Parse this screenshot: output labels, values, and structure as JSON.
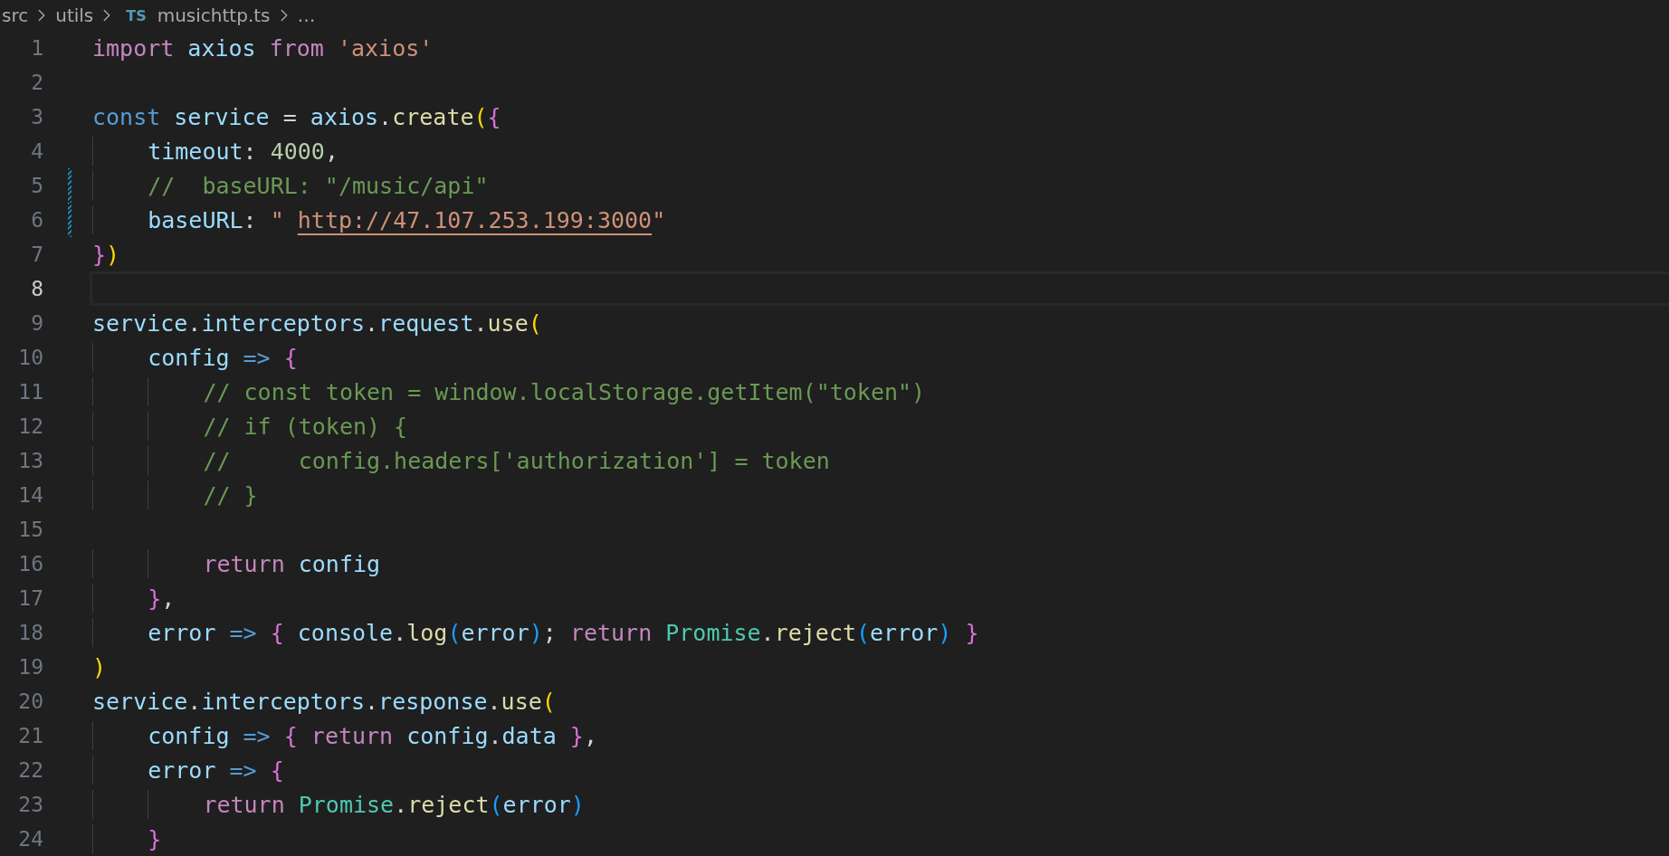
{
  "breadcrumb": [
    {
      "label": "src"
    },
    {
      "label": "utils"
    },
    {
      "label": "musichttp.ts",
      "badge": "TS"
    },
    {
      "label": "…"
    }
  ],
  "lines": [
    {
      "number": "1",
      "current": false,
      "modified": false,
      "tokens": [
        {
          "t": "import",
          "kind": "keyword"
        },
        {
          "t": " axios",
          "kind": "var"
        },
        {
          "t": " from",
          "kind": "keyword"
        },
        {
          "t": " 'axios'",
          "kind": "string"
        }
      ]
    },
    {
      "number": "2",
      "current": false,
      "modified": false
    },
    {
      "number": "3",
      "current": false,
      "modified": false,
      "tokens": [
        {
          "t": "const",
          "kind": "storage"
        },
        {
          "t": " service",
          "kind": "var"
        },
        {
          "t": " = ",
          "kind": "plain"
        },
        {
          "t": "axios",
          "kind": "var"
        },
        {
          "t": ".",
          "kind": "plain"
        },
        {
          "t": "create",
          "kind": "func"
        },
        {
          "t": "(",
          "kind": "bracket1"
        },
        {
          "t": "{",
          "kind": "bracket2"
        }
      ]
    },
    {
      "number": "4",
      "current": false,
      "modified": false,
      "tokens": [
        {
          "t": "    timeout",
          "kind": "var"
        },
        {
          "t": ": ",
          "kind": "plain"
        },
        {
          "t": "4000",
          "kind": "number"
        },
        {
          "t": ",",
          "kind": "plain"
        }
      ]
    },
    {
      "number": "5",
      "current": false,
      "modified": true,
      "tokens": [
        {
          "t": "    //  baseURL: \"/music/api\"",
          "kind": "comment"
        }
      ]
    },
    {
      "number": "6",
      "current": false,
      "modified": true,
      "tokens": [
        {
          "t": "    baseURL",
          "kind": "var"
        },
        {
          "t": ": ",
          "kind": "plain"
        },
        {
          "t": "\" ",
          "kind": "string"
        },
        {
          "t": "http://47.107.253.199:3000",
          "kind": "link"
        },
        {
          "t": "\"",
          "kind": "string"
        }
      ]
    },
    {
      "number": "7",
      "current": false,
      "modified": false,
      "tokens": [
        {
          "t": "}",
          "kind": "bracket2"
        },
        {
          "t": ")",
          "kind": "bracket1"
        }
      ]
    },
    {
      "number": "8",
      "current": true,
      "modified": false
    },
    {
      "number": "9",
      "current": false,
      "modified": false,
      "tokens": [
        {
          "t": "service",
          "kind": "var"
        },
        {
          "t": ".",
          "kind": "plain"
        },
        {
          "t": "interceptors",
          "kind": "var"
        },
        {
          "t": ".",
          "kind": "plain"
        },
        {
          "t": "request",
          "kind": "var"
        },
        {
          "t": ".",
          "kind": "plain"
        },
        {
          "t": "use",
          "kind": "func"
        },
        {
          "t": "(",
          "kind": "bracket1"
        }
      ]
    },
    {
      "number": "10",
      "current": false,
      "modified": false,
      "tokens": [
        {
          "t": "    config",
          "kind": "var"
        },
        {
          "t": " =>",
          "kind": "storage"
        },
        {
          "t": " {",
          "kind": "bracket2"
        }
      ]
    },
    {
      "number": "11",
      "current": false,
      "modified": false,
      "tokens": [
        {
          "t": "        // const token = window.localStorage.getItem(\"token\")",
          "kind": "comment"
        }
      ]
    },
    {
      "number": "12",
      "current": false,
      "modified": false,
      "tokens": [
        {
          "t": "        // if (token) {",
          "kind": "comment"
        }
      ]
    },
    {
      "number": "13",
      "current": false,
      "modified": false,
      "tokens": [
        {
          "t": "        //     config.headers['authorization'] = token",
          "kind": "comment"
        }
      ]
    },
    {
      "number": "14",
      "current": false,
      "modified": false,
      "tokens": [
        {
          "t": "        // }",
          "kind": "comment"
        }
      ]
    },
    {
      "number": "15",
      "current": false,
      "modified": false
    },
    {
      "number": "16",
      "current": false,
      "modified": false,
      "tokens": [
        {
          "t": "        return",
          "kind": "keyword"
        },
        {
          "t": " config",
          "kind": "var"
        }
      ]
    },
    {
      "number": "17",
      "current": false,
      "modified": false,
      "tokens": [
        {
          "t": "    }",
          "kind": "bracket2"
        },
        {
          "t": ",",
          "kind": "plain"
        }
      ]
    },
    {
      "number": "18",
      "current": false,
      "modified": false,
      "tokens": [
        {
          "t": "    error",
          "kind": "var"
        },
        {
          "t": " =>",
          "kind": "storage"
        },
        {
          "t": " {",
          "kind": "bracket2"
        },
        {
          "t": " console",
          "kind": "var"
        },
        {
          "t": ".",
          "kind": "plain"
        },
        {
          "t": "log",
          "kind": "func"
        },
        {
          "t": "(",
          "kind": "bracket3"
        },
        {
          "t": "error",
          "kind": "var"
        },
        {
          "t": ")",
          "kind": "bracket3"
        },
        {
          "t": "; ",
          "kind": "plain"
        },
        {
          "t": "return",
          "kind": "keyword"
        },
        {
          "t": " Promise",
          "kind": "class"
        },
        {
          "t": ".",
          "kind": "plain"
        },
        {
          "t": "reject",
          "kind": "func"
        },
        {
          "t": "(",
          "kind": "bracket3"
        },
        {
          "t": "error",
          "kind": "var"
        },
        {
          "t": ")",
          "kind": "bracket3"
        },
        {
          "t": " }",
          "kind": "bracket2"
        }
      ]
    },
    {
      "number": "19",
      "current": false,
      "modified": false,
      "tokens": [
        {
          "t": ")",
          "kind": "bracket1"
        }
      ]
    },
    {
      "number": "20",
      "current": false,
      "modified": false,
      "tokens": [
        {
          "t": "service",
          "kind": "var"
        },
        {
          "t": ".",
          "kind": "plain"
        },
        {
          "t": "interceptors",
          "kind": "var"
        },
        {
          "t": ".",
          "kind": "plain"
        },
        {
          "t": "response",
          "kind": "var"
        },
        {
          "t": ".",
          "kind": "plain"
        },
        {
          "t": "use",
          "kind": "func"
        },
        {
          "t": "(",
          "kind": "bracket1"
        }
      ]
    },
    {
      "number": "21",
      "current": false,
      "modified": false,
      "tokens": [
        {
          "t": "    config",
          "kind": "var"
        },
        {
          "t": " =>",
          "kind": "storage"
        },
        {
          "t": " {",
          "kind": "bracket2"
        },
        {
          "t": " return",
          "kind": "keyword"
        },
        {
          "t": " config",
          "kind": "var"
        },
        {
          "t": ".",
          "kind": "plain"
        },
        {
          "t": "data",
          "kind": "var"
        },
        {
          "t": " }",
          "kind": "bracket2"
        },
        {
          "t": ",",
          "kind": "plain"
        }
      ]
    },
    {
      "number": "22",
      "current": false,
      "modified": false,
      "tokens": [
        {
          "t": "    error",
          "kind": "var"
        },
        {
          "t": " =>",
          "kind": "storage"
        },
        {
          "t": " {",
          "kind": "bracket2"
        }
      ]
    },
    {
      "number": "23",
      "current": false,
      "modified": false,
      "tokens": [
        {
          "t": "        return",
          "kind": "keyword"
        },
        {
          "t": " Promise",
          "kind": "class"
        },
        {
          "t": ".",
          "kind": "plain"
        },
        {
          "t": "reject",
          "kind": "func"
        },
        {
          "t": "(",
          "kind": "bracket3"
        },
        {
          "t": "error",
          "kind": "var"
        },
        {
          "t": ")",
          "kind": "bracket3"
        }
      ]
    },
    {
      "number": "24",
      "current": false,
      "modified": false,
      "tokens": [
        {
          "t": "    }",
          "kind": "bracket2"
        }
      ]
    }
  ]
}
